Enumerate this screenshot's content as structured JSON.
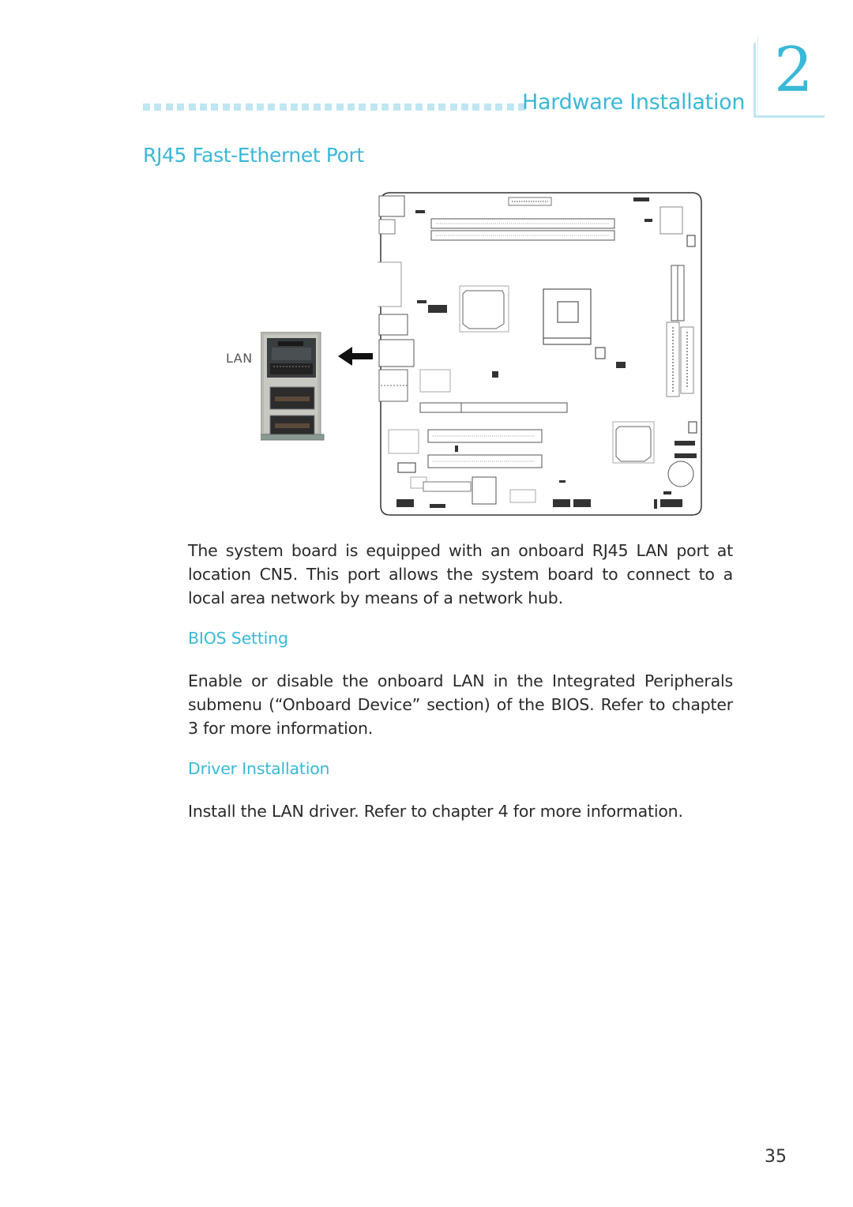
{
  "header": {
    "chapter_title": "Hardware Installation",
    "chapter_number": "2",
    "dot_count": 34,
    "accent_color": "#3ab8d8"
  },
  "section": {
    "title": "RJ45 Fast-Ethernet Port"
  },
  "figure": {
    "port_label": "LAN",
    "arrow_icon": "left-arrow",
    "board_diagram": "system-board-layout",
    "port_photo": "rj45-lan-usb-port-stack"
  },
  "body": {
    "intro": "The system board is equipped with an onboard RJ45 LAN port at location CN5. This port allows the system board to connect to a local area network by means of a network hub.",
    "bios_heading": "BIOS Setting",
    "bios_text": "Enable or disable the onboard LAN in the Integrated Peripherals submenu (“Onboard Device” section) of the BIOS. Refer to chapter 3 for more information.",
    "driver_heading": "Driver Installation",
    "driver_text": "Install the LAN driver. Refer to chapter 4 for more information."
  },
  "footer": {
    "page_number": "35"
  }
}
